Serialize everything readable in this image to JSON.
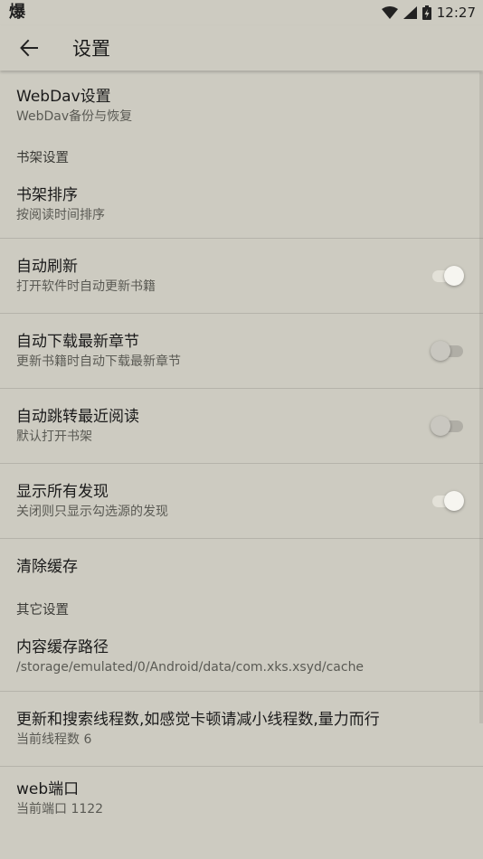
{
  "status_bar": {
    "left_icon_char": "爆",
    "time": "12:27",
    "icons": [
      "wifi-icon",
      "cell-signal-icon",
      "battery-icon"
    ]
  },
  "toolbar": {
    "title": "设置",
    "back_icon": "arrow-left-icon"
  },
  "items": [
    {
      "kind": "pref",
      "title": "WebDav设置",
      "summary": "WebDav备份与恢复"
    },
    {
      "kind": "category",
      "title": "书架设置"
    },
    {
      "kind": "pref",
      "title": "书架排序",
      "summary": "按阅读时间排序"
    },
    {
      "kind": "switch",
      "title": "自动刷新",
      "summary": "打开软件时自动更新书籍",
      "checked": true
    },
    {
      "kind": "switch",
      "title": "自动下载最新章节",
      "summary": "更新书籍时自动下载最新章节",
      "checked": false
    },
    {
      "kind": "switch",
      "title": "自动跳转最近阅读",
      "summary": "默认打开书架",
      "checked": false
    },
    {
      "kind": "switch",
      "title": "显示所有发现",
      "summary": "关闭则只显示勾选源的发现",
      "checked": true
    },
    {
      "kind": "pref",
      "title": "清除缓存",
      "summary": ""
    },
    {
      "kind": "category",
      "title": "其它设置"
    },
    {
      "kind": "pref",
      "title": "内容缓存路径",
      "summary": "/storage/emulated/0/Android/data/com.xks.xsyd/cache"
    },
    {
      "kind": "pref",
      "title": "更新和搜索线程数,如感觉卡顿请减小线程数,量力而行",
      "summary": "当前线程数 6"
    },
    {
      "kind": "pref",
      "title": "web端口",
      "summary": "当前端口 1122"
    }
  ],
  "colors": {
    "background": "#cdcbc1",
    "divider": "#b5b3aa",
    "switch_on_thumb": "#f6f5f0",
    "switch_off_thumb": "#c9c7c0"
  }
}
